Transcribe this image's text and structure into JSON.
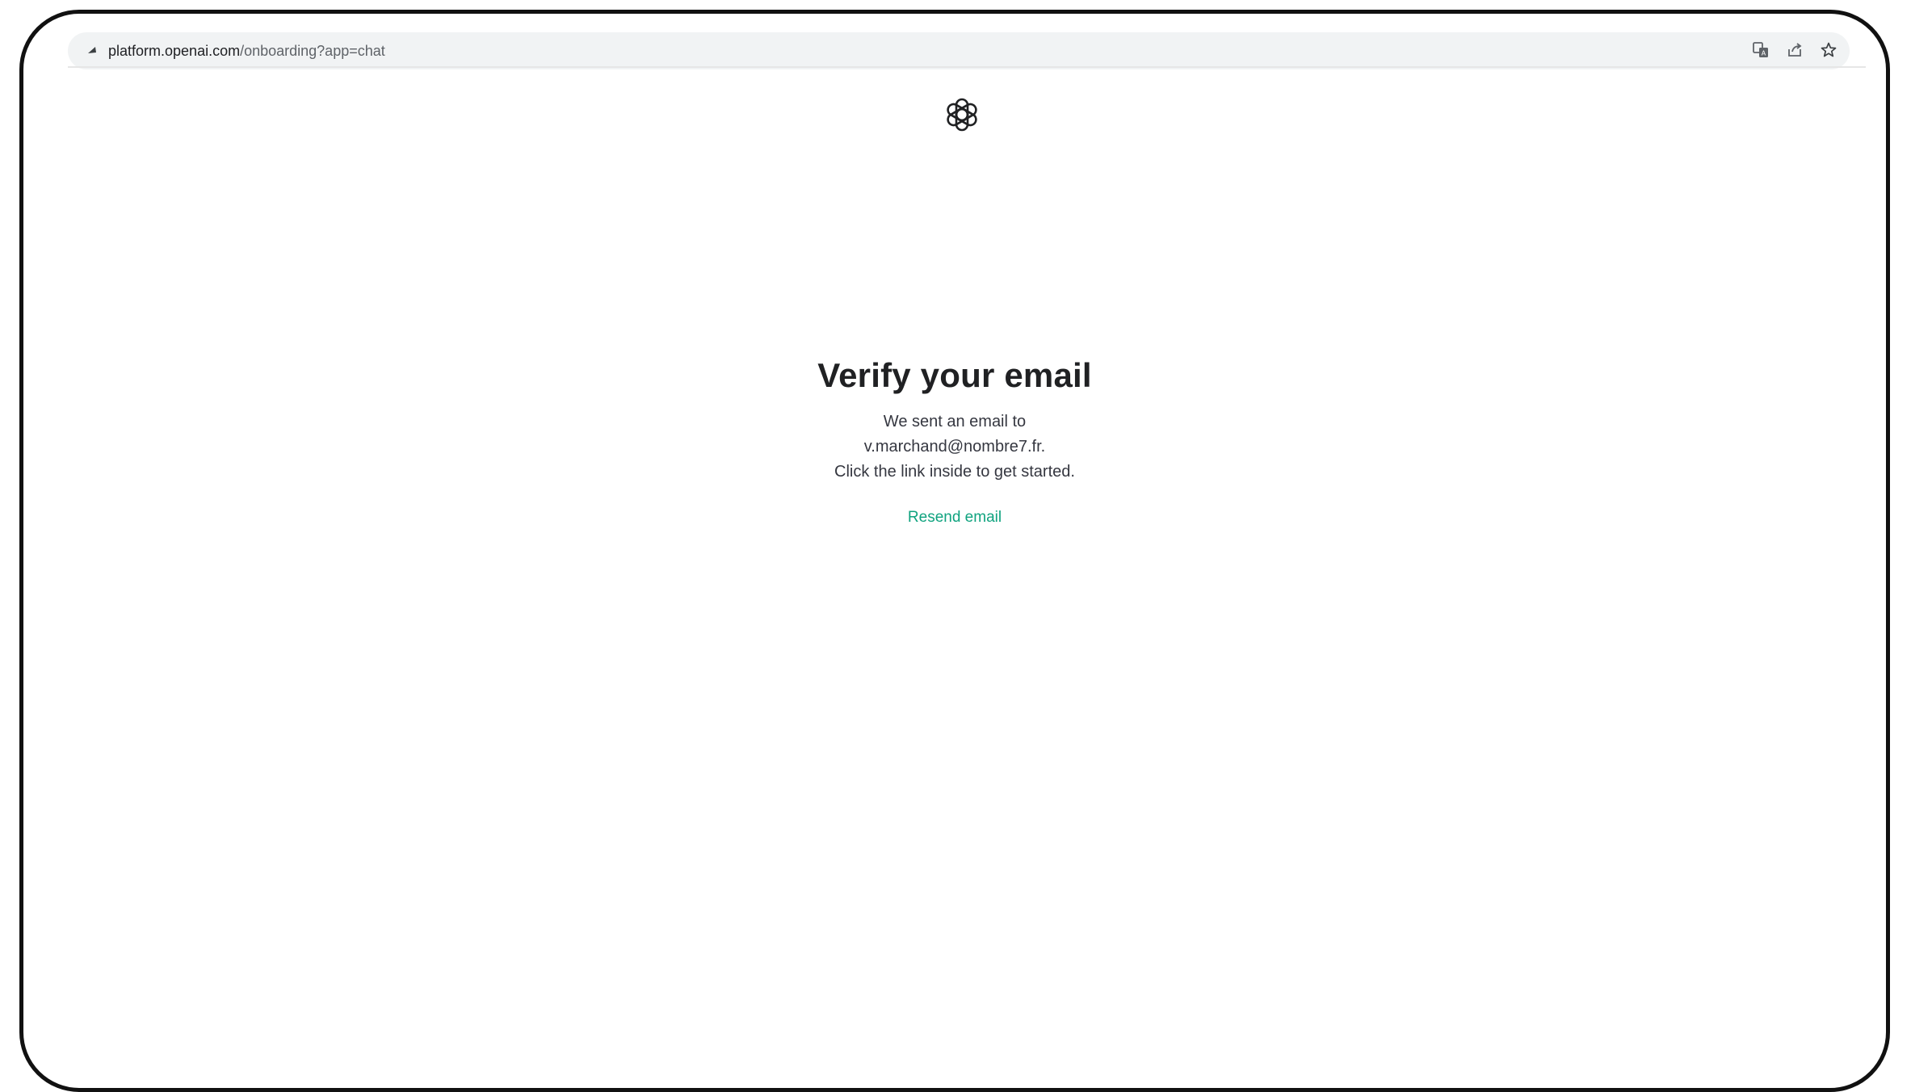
{
  "browser": {
    "url_host": "platform.openai.com",
    "url_path": "/onboarding?app=chat",
    "icons": [
      "translate-icon",
      "share-icon",
      "bookmark-star-icon"
    ]
  },
  "page": {
    "logo": "openai-logo-icon",
    "title": "Verify your email",
    "line1": "We sent an email to",
    "email": "v.marchand@nombre7.fr.",
    "line3": "Click the link inside to get started.",
    "resend_label": "Resend email"
  },
  "colors": {
    "accent": "#10a37f",
    "title": "#202123",
    "text": "#353740",
    "address_bar": "#f1f3f4"
  }
}
